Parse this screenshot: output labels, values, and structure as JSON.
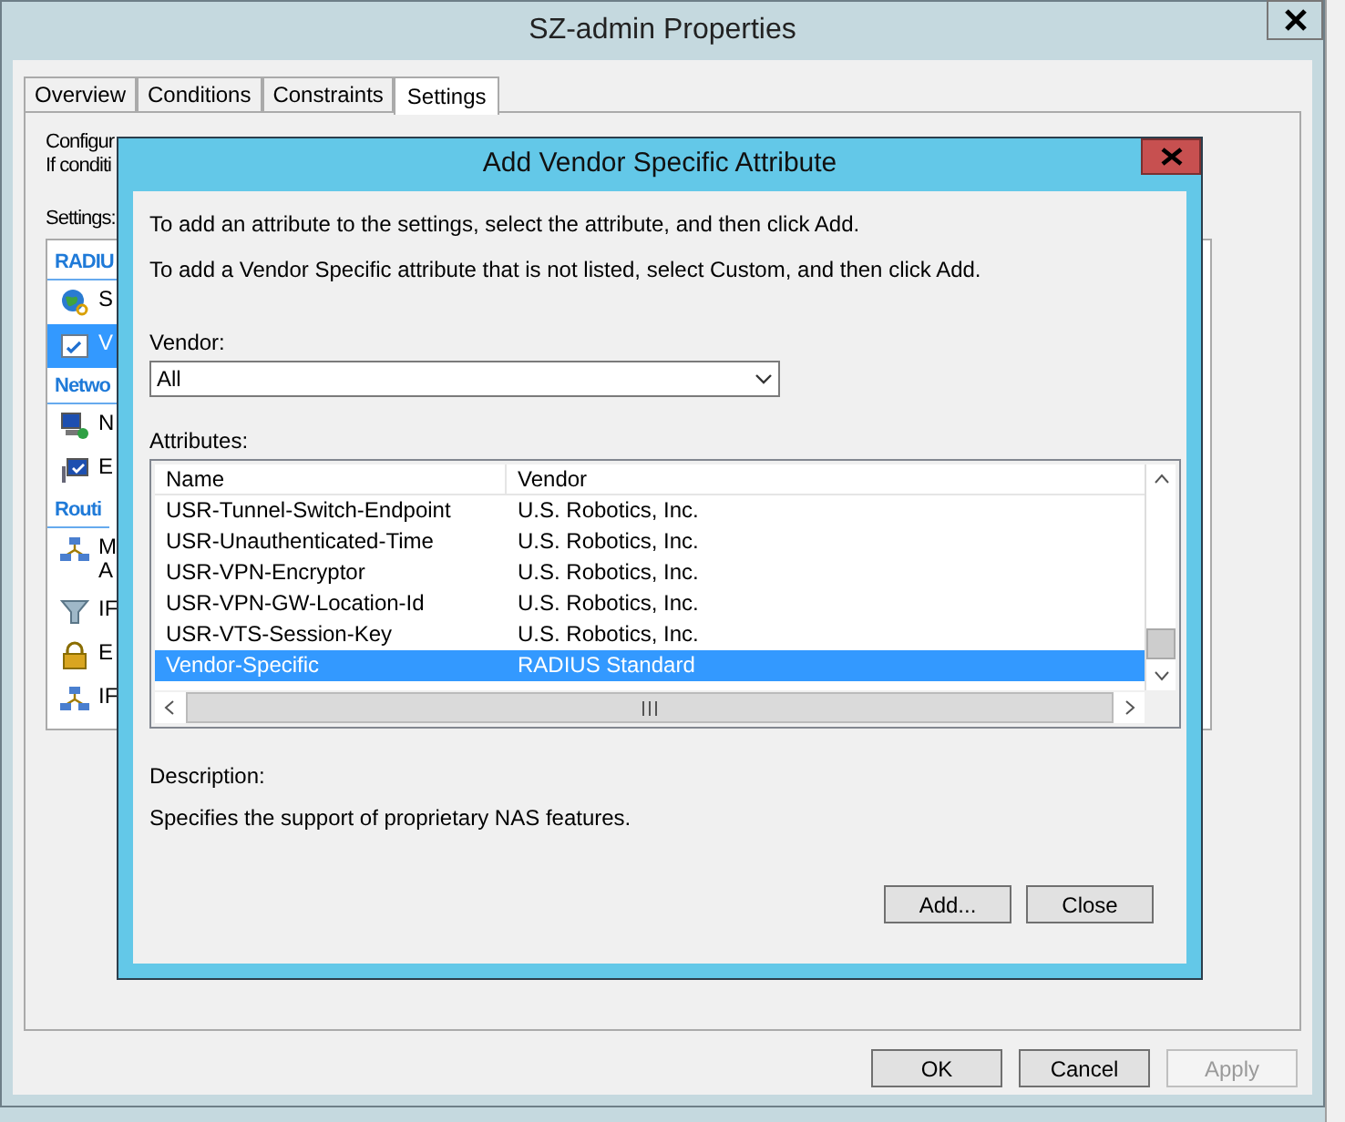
{
  "window": {
    "title": "SZ-admin Properties"
  },
  "tabs": [
    {
      "label": "Overview",
      "selected": false
    },
    {
      "label": "Conditions",
      "selected": false
    },
    {
      "label": "Constraints",
      "selected": false
    },
    {
      "label": "Settings",
      "selected": true
    }
  ],
  "panel": {
    "intro_lines": [
      "Configur",
      "If conditi"
    ],
    "settings_label": "Settings:",
    "groups": [
      {
        "heading": "RADIU",
        "items": [
          {
            "kind": "globe",
            "lines": [
              "S"
            ],
            "selected": false
          },
          {
            "kind": "checklist",
            "lines": [
              "V"
            ],
            "selected": true
          }
        ]
      },
      {
        "heading": "Netwo",
        "items": [
          {
            "kind": "computer",
            "lines": [
              "N"
            ],
            "selected": false
          },
          {
            "kind": "monitor",
            "lines": [
              "E"
            ],
            "selected": false
          }
        ]
      },
      {
        "heading": "Routi",
        "items": [
          {
            "kind": "network",
            "lines": [
              "M",
              "A"
            ],
            "selected": false
          },
          {
            "kind": "filter",
            "lines": [
              "IF"
            ],
            "selected": false
          },
          {
            "kind": "lock",
            "lines": [
              "E"
            ],
            "selected": false
          },
          {
            "kind": "network",
            "lines": [
              "IF"
            ],
            "selected": false
          }
        ]
      }
    ]
  },
  "buttons": [
    {
      "label": "OK",
      "disabled": false
    },
    {
      "label": "Cancel",
      "disabled": false
    },
    {
      "label": "Apply",
      "disabled": true
    }
  ],
  "dialog": {
    "title": "Add Vendor Specific Attribute",
    "instructions": [
      "To add an attribute to the settings, select the attribute, and then click Add.",
      "To add a Vendor Specific attribute that is not listed, select Custom, and then click Add."
    ],
    "vendor_label": "Vendor:",
    "vendor_value": "All",
    "attributes_label": "Attributes:",
    "columns": [
      "Name",
      "Vendor"
    ],
    "rows": [
      {
        "name": "USR-Tunnel-Switch-Endpoint",
        "vendor": "U.S. Robotics, Inc.",
        "selected": false
      },
      {
        "name": "USR-Unauthenticated-Time",
        "vendor": "U.S. Robotics, Inc.",
        "selected": false
      },
      {
        "name": "USR-VPN-Encryptor",
        "vendor": "U.S. Robotics, Inc.",
        "selected": false
      },
      {
        "name": "USR-VPN-GW-Location-Id",
        "vendor": "U.S. Robotics, Inc.",
        "selected": false
      },
      {
        "name": "USR-VTS-Session-Key",
        "vendor": "U.S. Robotics, Inc.",
        "selected": false
      },
      {
        "name": "Vendor-Specific",
        "vendor": "RADIUS Standard",
        "selected": true
      }
    ],
    "description_label": "Description:",
    "description": "Specifies the support of proprietary NAS features.",
    "buttons": [
      {
        "label": "Add..."
      },
      {
        "label": "Close"
      }
    ]
  }
}
